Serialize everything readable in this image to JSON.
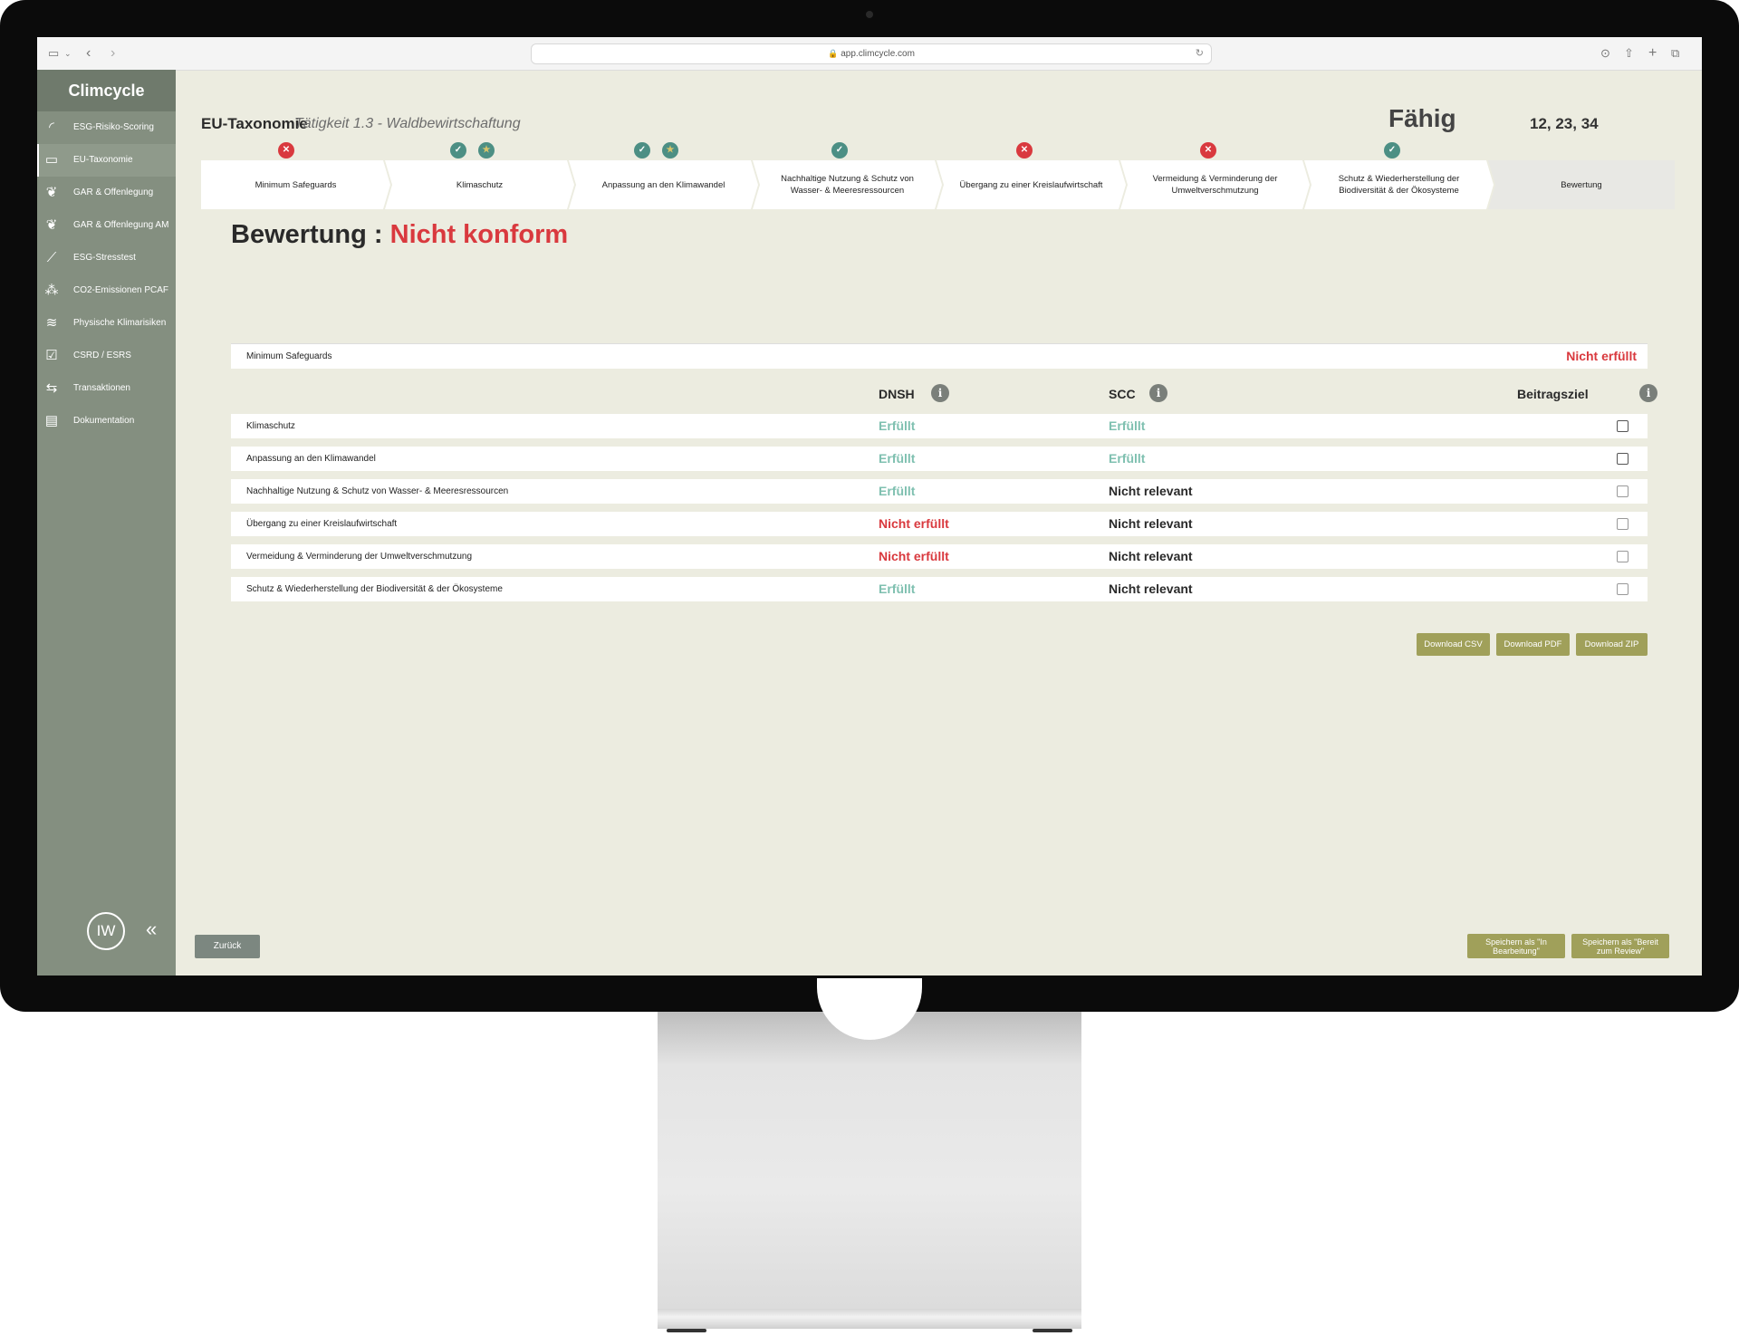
{
  "browser": {
    "url": "app.climcycle.com"
  },
  "sidebar": {
    "logo": "Climcycle",
    "items": [
      {
        "label": "ESG-Risiko-Scoring",
        "icon": "gauge-icon"
      },
      {
        "label": "EU-Taxonomie",
        "icon": "map-icon",
        "active": true
      },
      {
        "label": "GAR & Offenlegung",
        "icon": "plant-hand-icon"
      },
      {
        "label": "GAR & Offenlegung AM",
        "icon": "plant-hand-icon"
      },
      {
        "label": "ESG-Stresstest",
        "icon": "chart-line-icon"
      },
      {
        "label": "CO2-Emissionen PCAF",
        "icon": "footprint-icon"
      },
      {
        "label": "Physische Klimarisiken",
        "icon": "tornado-icon"
      },
      {
        "label": "CSRD / ESRS",
        "icon": "checklist-icon"
      },
      {
        "label": "Transaktionen",
        "icon": "arrows-swap-icon"
      },
      {
        "label": "Dokumentation",
        "icon": "document-icon"
      }
    ],
    "avatar": "IW"
  },
  "header": {
    "title": "EU-Taxonomie",
    "subtitle": "Tätigkeit 1.3 - Waldbewirtschaftung",
    "status": "Fähig",
    "codes": "12, 23, 34"
  },
  "steps": [
    {
      "label": "Minimum Safeguards",
      "badges": [
        "error"
      ]
    },
    {
      "label": "Klimaschutz",
      "badges": [
        "ok",
        "star"
      ]
    },
    {
      "label": "Anpassung an den Klimawandel",
      "badges": [
        "ok",
        "star"
      ]
    },
    {
      "label": "Nachhaltige Nutzung & Schutz von Wasser- & Meeresressourcen",
      "badges": [
        "ok"
      ]
    },
    {
      "label": "Übergang zu einer Kreislaufwirtschaft",
      "badges": [
        "error"
      ]
    },
    {
      "label": "Vermeidung & Verminderung der Umweltverschmutzung",
      "badges": [
        "error"
      ]
    },
    {
      "label": "Schutz & Wiederherstellung der Biodiversität & der Ökosysteme",
      "badges": [
        "ok"
      ]
    },
    {
      "label": "Bewertung",
      "badges": []
    }
  ],
  "assessment": {
    "label": "Bewertung :",
    "result": "Nicht konform",
    "minimum_safeguards": {
      "label": "Minimum Safeguards",
      "status": "Nicht erfüllt"
    },
    "columns": {
      "dnsh": "DNSH",
      "scc": "SCC",
      "goal": "Beitragsziel"
    },
    "rows": [
      {
        "label": "Klimaschutz",
        "dnsh": "Erfüllt",
        "scc": "Erfüllt",
        "goal": false
      },
      {
        "label": "Anpassung an den Klimawandel",
        "dnsh": "Erfüllt",
        "scc": "Erfüllt",
        "goal": false
      },
      {
        "label": "Nachhaltige Nutzung & Schutz von Wasser- & Meeresressourcen",
        "dnsh": "Erfüllt",
        "scc": "Nicht relevant",
        "goal": false
      },
      {
        "label": "Übergang zu einer Kreislaufwirtschaft",
        "dnsh": "Nicht erfüllt",
        "scc": "Nicht relevant",
        "goal": false
      },
      {
        "label": "Vermeidung & Verminderung der Umweltverschmutzung",
        "dnsh": "Nicht erfüllt",
        "scc": "Nicht relevant",
        "goal": false
      },
      {
        "label": "Schutz & Wiederherstellung der Biodiversität & der Ökosysteme",
        "dnsh": "Erfüllt",
        "scc": "Nicht relevant",
        "goal": false
      }
    ]
  },
  "downloads": {
    "csv": "Download CSV",
    "pdf": "Download PDF",
    "zip": "Download ZIP"
  },
  "footer": {
    "back": "Zurück",
    "save_in_progress": "Speichern als \"In Bearbeitung\"",
    "save_ready": "Speichern als \"Bereit zum Review\""
  },
  "colors": {
    "accent_red": "#d9393e",
    "accent_green": "#7fc0b0",
    "teal": "#4c8f84",
    "olive_button": "#a0a05a",
    "sidebar": "#848f80"
  }
}
